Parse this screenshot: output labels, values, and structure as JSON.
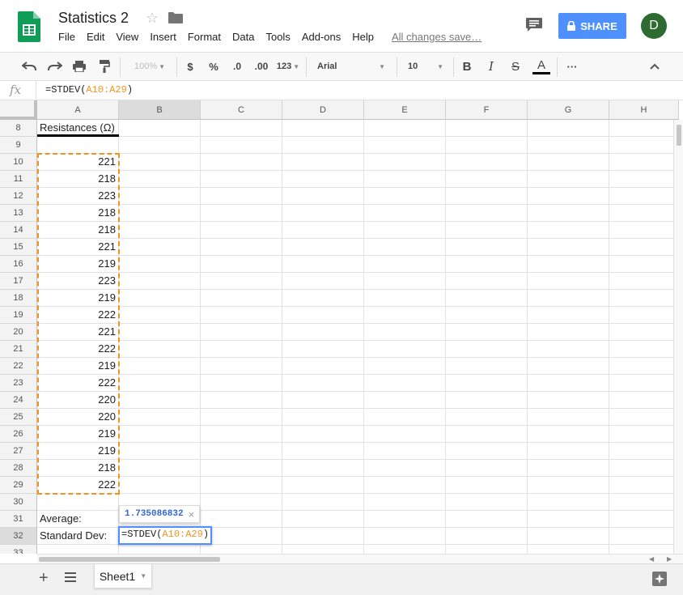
{
  "app": {
    "title": "Statistics 2",
    "saved_status": "All changes save…",
    "share_label": "SHARE",
    "avatar_letter": "D",
    "brand_color": "#0f9d58",
    "accent_color": "#4d90fe"
  },
  "menu": [
    "File",
    "Edit",
    "View",
    "Insert",
    "Format",
    "Data",
    "Tools",
    "Add-ons",
    "Help"
  ],
  "toolbar": {
    "zoom": "100%",
    "currency": "$",
    "percent": "%",
    "decrease_decimals": ".0",
    "increase_decimals": ".00",
    "more_formats": "123",
    "font": "Arial",
    "font_size": "10",
    "bold": "B",
    "italic": "I",
    "strikethrough": "S",
    "text_color": "A",
    "more": "···"
  },
  "formula_bar": {
    "fx": "fx",
    "prefix": "=STDEV(",
    "range": "A10:A29",
    "suffix": ")"
  },
  "columns": [
    "A",
    "B",
    "C",
    "D",
    "E",
    "F",
    "G",
    "H"
  ],
  "rows": [
    "8",
    "9",
    "10",
    "11",
    "12",
    "13",
    "14",
    "15",
    "16",
    "17",
    "18",
    "19",
    "20",
    "21",
    "22",
    "23",
    "24",
    "25",
    "26",
    "27",
    "28",
    "29",
    "30",
    "31",
    "32",
    "33"
  ],
  "cells": {
    "a8": "Resistances (Ω)",
    "a31": "Average:",
    "a32": "Standard Dev:",
    "values": [
      221,
      218,
      223,
      218,
      218,
      221,
      219,
      223,
      219,
      222,
      221,
      222,
      219,
      222,
      220,
      220,
      219,
      219,
      218,
      222
    ]
  },
  "edit": {
    "prefix": "=STDEV(",
    "range": "A10:A29",
    "suffix": ")",
    "preview": "1.735086832",
    "close": "×"
  },
  "sheets": [
    "Sheet1"
  ],
  "icons": {
    "add_sheet": "+",
    "star": "☆"
  }
}
